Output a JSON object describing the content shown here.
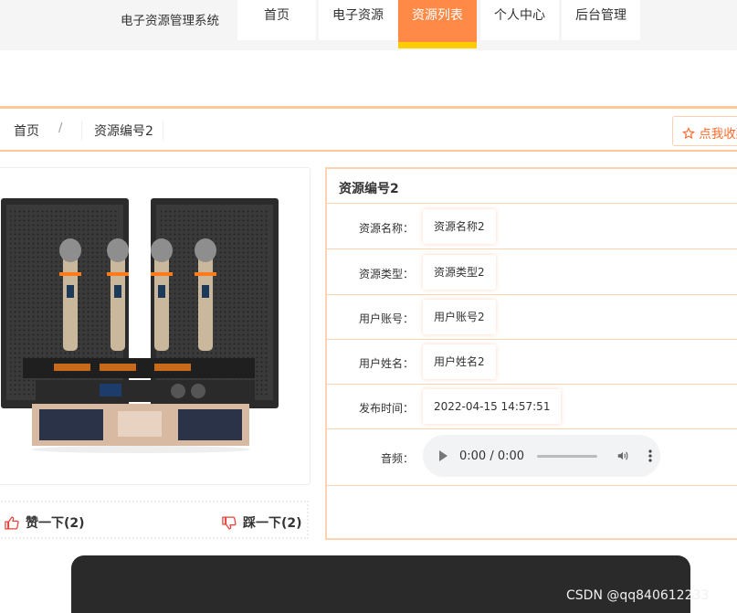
{
  "header": {
    "site_title": "电子资源管理系统",
    "nav": [
      "首页",
      "电子资源",
      "资源列表",
      "个人中心",
      "后台管理"
    ],
    "active_index": 2
  },
  "breadcrumb": {
    "home": "首页",
    "separator": "/",
    "current": "资源编号2",
    "favorite_label": "点我收藏"
  },
  "votes": {
    "like_label": "赞一下(2)",
    "dislike_label": "踩一下(2)"
  },
  "detail": {
    "title": "资源编号2",
    "fields": [
      {
        "label": "资源名称：",
        "value": "资源名称2"
      },
      {
        "label": "资源类型：",
        "value": "资源类型2"
      },
      {
        "label": "用户账号：",
        "value": "用户账号2"
      },
      {
        "label": "用户姓名：",
        "value": "用户姓名2"
      },
      {
        "label": "发布时间：",
        "value": "2022-04-15 14:57:51"
      }
    ],
    "audio_label": "音频：",
    "audio_time": "0:00 / 0:00"
  },
  "watermark": "CSDN @qq840612233",
  "colors": {
    "accent": "#ff8a47",
    "accent_underline": "#ffcc00",
    "border": "#ffd3b0",
    "icon_red": "#e8423a"
  }
}
